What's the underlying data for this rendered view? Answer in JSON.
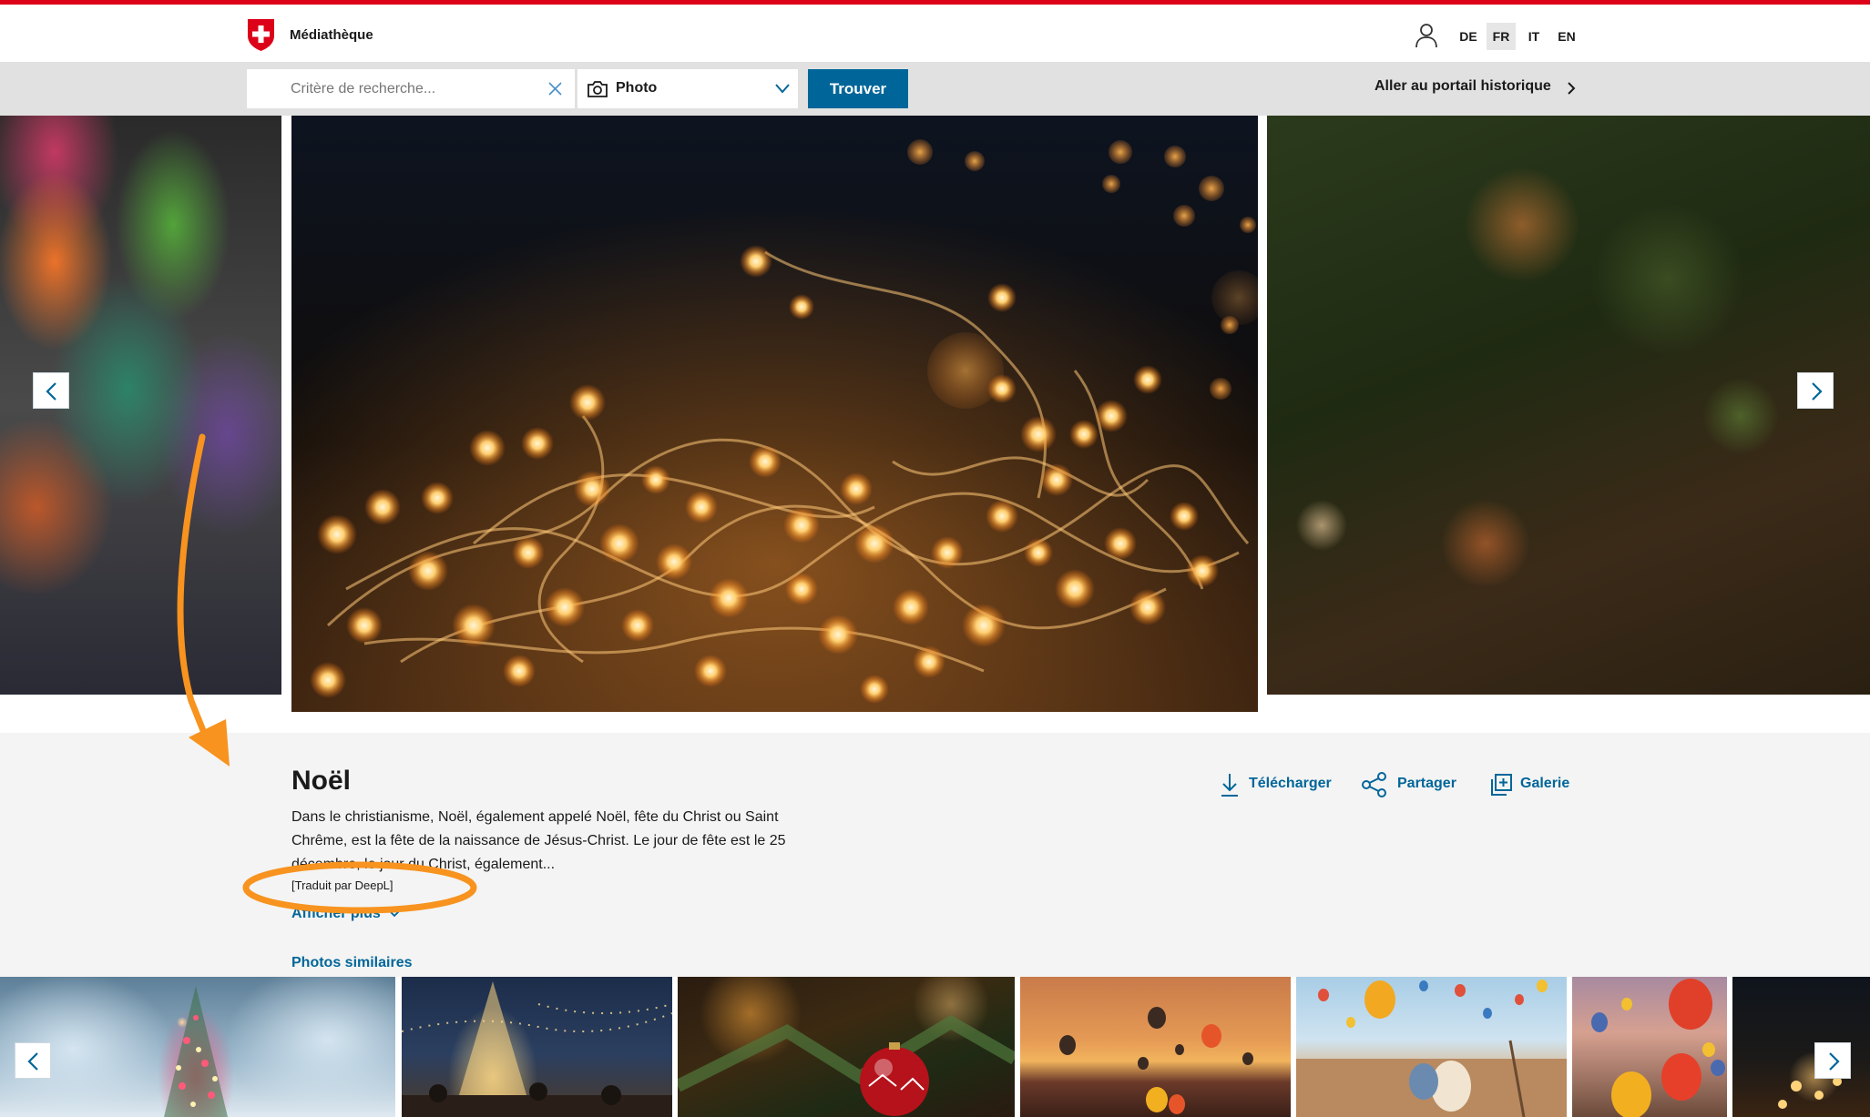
{
  "header": {
    "site_title": "Médiathèque",
    "languages": [
      {
        "code": "DE",
        "active": false
      },
      {
        "code": "FR",
        "active": true
      },
      {
        "code": "IT",
        "active": false
      },
      {
        "code": "EN",
        "active": false
      }
    ],
    "accent_color": "#dc0018"
  },
  "search": {
    "placeholder": "Critère de recherche...",
    "value": "",
    "type_selected": "Photo",
    "find_label": "Trouver",
    "historic_link": "Aller au portail historique",
    "button_color": "#006699"
  },
  "carousel": {
    "prev_icon": "chevron-left-icon",
    "next_icon": "chevron-right-icon"
  },
  "media": {
    "title": "Noël",
    "description": "Dans le christianisme, Noël, également appelé Noël, fête du Christ ou Saint Chrême, est la fête de la naissance de Jésus-Christ. Le jour de fête est le 25 décembre, le jour du Christ, également...",
    "translation_note": "[Traduit par DeepL]",
    "show_more": "Afficher plus",
    "actions": {
      "download": "Télécharger",
      "share": "Partager",
      "gallery": "Galerie"
    },
    "link_color": "#006699"
  },
  "similar": {
    "label": "Photos similaires"
  },
  "annotation": {
    "color": "#f7931e"
  }
}
